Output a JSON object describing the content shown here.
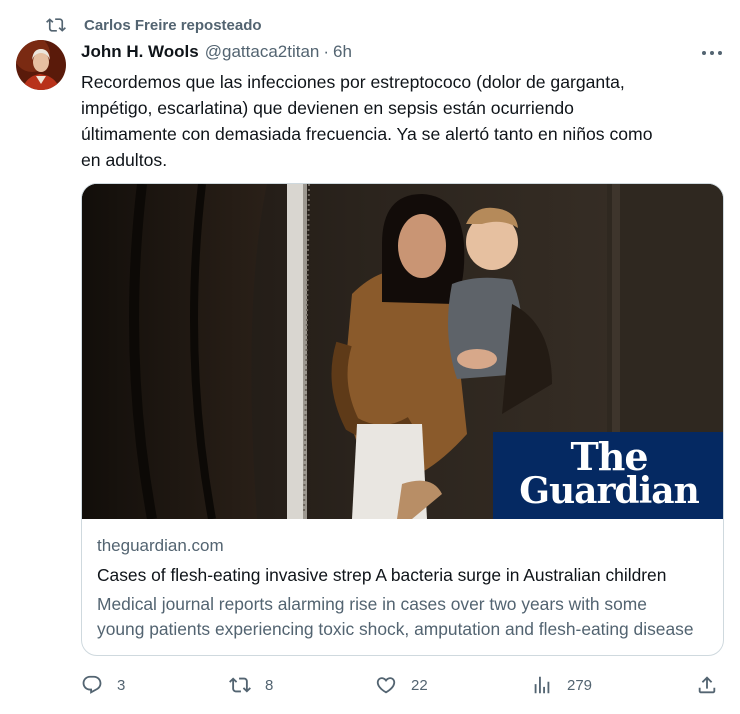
{
  "repost": {
    "label": "Carlos Freire reposteado",
    "icon": "repost-icon"
  },
  "author": {
    "name": "John H. Wools",
    "handle": "@gattaca2titan",
    "separator": "·",
    "time": "6h"
  },
  "tweet_text": [
    "Recordemos que las infecciones por estreptococo (dolor de garganta,",
    "impétigo, escarlatina)  que devienen en sepsis están ocurriendo",
    "últimamente con demasiada frecuencia. Ya se alertó tanto en niños como",
    "en adultos."
  ],
  "card": {
    "image_logo": {
      "line1": "The",
      "line2": "Guardian"
    },
    "domain": "theguardian.com",
    "title": "Cases of flesh-eating invasive strep A bacteria surge in Australian children",
    "description": [
      "Medical journal reports alarming rise in cases over two years with some",
      "young patients experiencing toxic shock, amputation and flesh-eating disease"
    ]
  },
  "actions": {
    "replies": "3",
    "reposts": "8",
    "likes": "22",
    "views": "279"
  },
  "colors": {
    "text_primary": "#0f1419",
    "text_secondary": "#536471",
    "border": "#cfd9de",
    "guardian_blue": "#052962"
  }
}
